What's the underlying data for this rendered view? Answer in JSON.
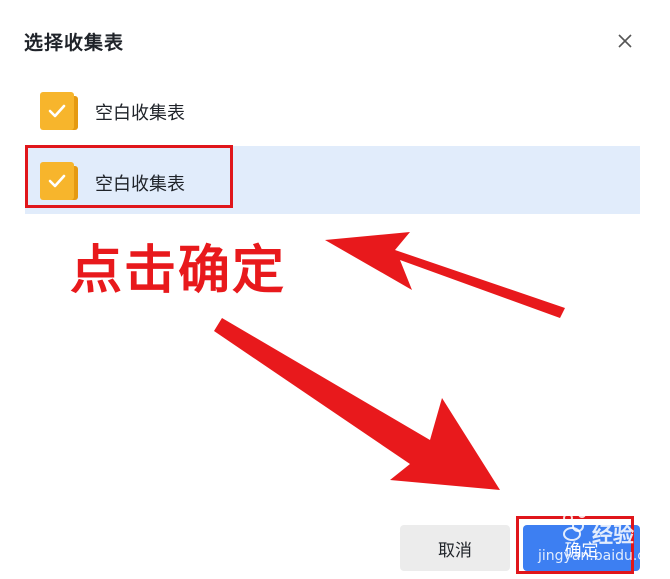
{
  "dialog": {
    "title": "选择收集表",
    "close_icon": "close-icon"
  },
  "items": [
    {
      "label": "空白收集表",
      "icon": "folder-check-icon",
      "selected": false
    },
    {
      "label": "空白收集表",
      "icon": "folder-check-icon",
      "selected": true
    }
  ],
  "annotation": {
    "text": "点击确定",
    "color": "#e8191c"
  },
  "buttons": {
    "cancel_label": "取消",
    "ok_label": "确定"
  },
  "watermark": {
    "brand": "经验",
    "url": "jingyan.baidu.com"
  },
  "colors": {
    "selected_row": "#e1ecfb",
    "primary": "#3d7ff2",
    "highlight": "#e0161b",
    "folder": "#f7b52c"
  }
}
